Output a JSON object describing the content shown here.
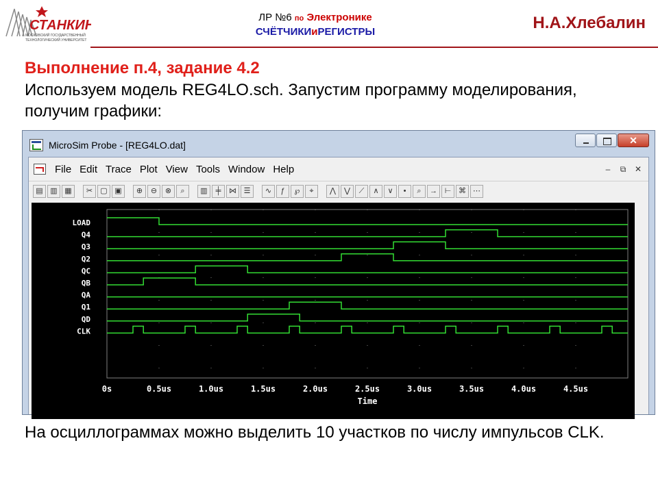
{
  "header": {
    "line1_prefix": "ЛР №6",
    "line1_po": "по",
    "line1_subject": "Электронике",
    "line2_part1": "СЧЁТЧИКИ",
    "line2_and": "и",
    "line2_part2": "РЕГИСТРЫ",
    "author": "Н.А.Хлебалин",
    "logo": {
      "name": "СТАНКИН",
      "subtitle_1": "МОСКОВСКИЙ ГОСУДАРСТВЕННЫЙ",
      "subtitle_2": "ТЕХНОЛОГИЧЕСКИЙ УНИВЕРСИТЕТ",
      "color": "#c1161b"
    }
  },
  "slide": {
    "title": "Выполнение п.4, задание 4.2",
    "intro": "Используем модель REG4LO.sch. Запустим программу моделирования, получим графики:",
    "footer": "На осциллограммах можно выделить 10 участков по числу импульсов CLK."
  },
  "window": {
    "title": "MicroSim Probe - [REG4LO.dat]",
    "menu": [
      "File",
      "Edit",
      "Trace",
      "Plot",
      "View",
      "Tools",
      "Window",
      "Help"
    ],
    "toolbar_icons": [
      "open-icon",
      "open-folder-icon",
      "print-icon",
      "cut-icon",
      "copy-icon",
      "paste-icon",
      "zoom-in-icon",
      "zoom-out-icon",
      "zoom-area-icon",
      "zoom-fit-icon",
      "bars-icon",
      "axis-icon",
      "fourier-icon",
      "list-icon",
      "add-trace-icon",
      "eval-icon",
      "measure-icon",
      "cursor-icon",
      "cursor-peak-icon",
      "cursor-trough-icon",
      "cursor-slope-icon",
      "cursor-min-icon",
      "cursor-max-icon",
      "cursor-point-icon",
      "cursor-search-icon",
      "cursor-next-icon",
      "cursor-edge-icon",
      "label-icon",
      "mark-icon"
    ]
  },
  "chart_data": {
    "type": "line",
    "subtype": "digital-timing",
    "xlabel": "Time",
    "x_ticks": [
      "0s",
      "0.5us",
      "1.0us",
      "1.5us",
      "2.0us",
      "2.5us",
      "3.0us",
      "3.5us",
      "4.0us",
      "4.5us"
    ],
    "xlim": [
      0,
      5.0
    ],
    "x_unit": "us",
    "grid": true,
    "colors": {
      "background": "#000000",
      "trace": "#33dd33",
      "text": "#ffffff",
      "grid": "#808080"
    },
    "series": [
      {
        "name": "LOAD",
        "initial": 1,
        "transitions": [
          0.5
        ]
      },
      {
        "name": "Q4",
        "initial": 0,
        "transitions": [
          3.25,
          3.75
        ]
      },
      {
        "name": "Q3",
        "initial": 0,
        "transitions": [
          2.75,
          3.25
        ]
      },
      {
        "name": "Q2",
        "initial": 0,
        "transitions": [
          2.25,
          2.75
        ]
      },
      {
        "name": "QC",
        "initial": 0,
        "transitions": [
          0.85,
          1.35
        ]
      },
      {
        "name": "QB",
        "initial": 0,
        "transitions": [
          0.35,
          0.85
        ]
      },
      {
        "name": "QA",
        "initial": 0,
        "transitions": []
      },
      {
        "name": "Q1",
        "initial": 0,
        "transitions": [
          1.75,
          2.25
        ]
      },
      {
        "name": "QD",
        "initial": 0,
        "transitions": [
          1.35,
          1.85
        ]
      },
      {
        "name": "CLK",
        "initial": 0,
        "transitions": [
          0.25,
          0.35,
          0.75,
          0.85,
          1.25,
          1.35,
          1.75,
          1.85,
          2.25,
          2.35,
          2.75,
          2.85,
          3.25,
          3.35,
          3.75,
          3.85,
          4.25,
          4.35,
          4.75,
          4.85
        ]
      }
    ]
  }
}
